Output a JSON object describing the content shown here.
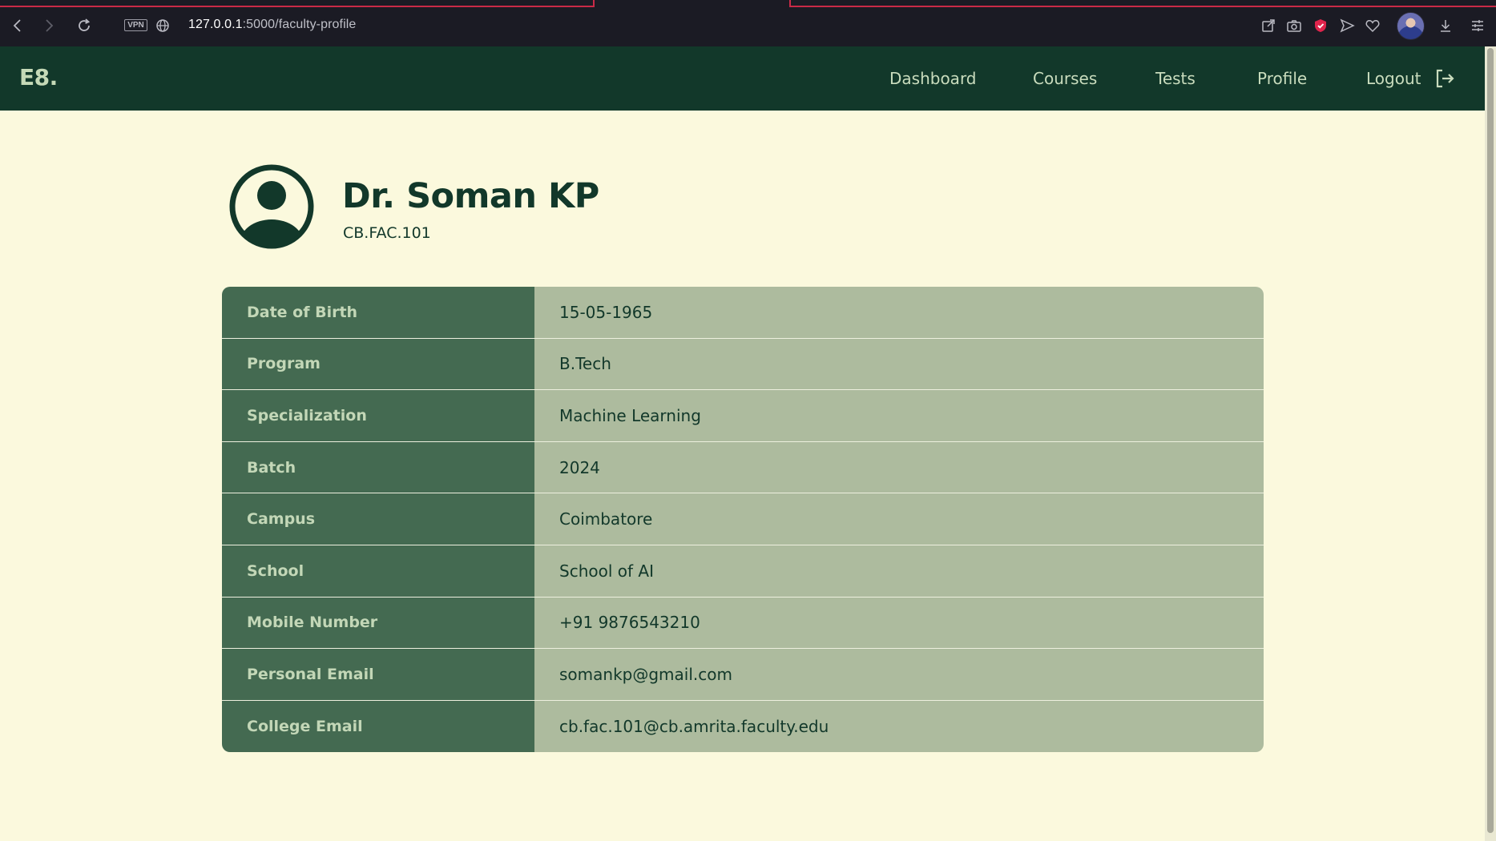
{
  "browser": {
    "url_host": "127.0.0.1",
    "url_rest": ":5000/faculty-profile",
    "vpn_label": "VPN"
  },
  "nav": {
    "logo": "E8.",
    "links": [
      "Dashboard",
      "Courses",
      "Tests",
      "Profile",
      "Logout"
    ]
  },
  "profile": {
    "name": "Dr. Soman KP",
    "id": "CB.FAC.101"
  },
  "details": [
    {
      "label": "Date of Birth",
      "value": "15-05-1965"
    },
    {
      "label": "Program",
      "value": "B.Tech"
    },
    {
      "label": "Specialization",
      "value": "Machine Learning"
    },
    {
      "label": "Batch",
      "value": "2024"
    },
    {
      "label": "Campus",
      "value": "Coimbatore"
    },
    {
      "label": "School",
      "value": "School of AI"
    },
    {
      "label": "Mobile Number",
      "value": "+91 9876543210"
    },
    {
      "label": "Personal Email",
      "value": "somankp@gmail.com"
    },
    {
      "label": "College Email",
      "value": "cb.fac.101@cb.amrita.faculty.edu"
    }
  ],
  "colors": {
    "navbar": "#12382a",
    "page_bg": "#fbf9dd",
    "key_cell": "#446a51",
    "value_cell": "#adbb9e",
    "accent_tab": "#c92a47"
  }
}
